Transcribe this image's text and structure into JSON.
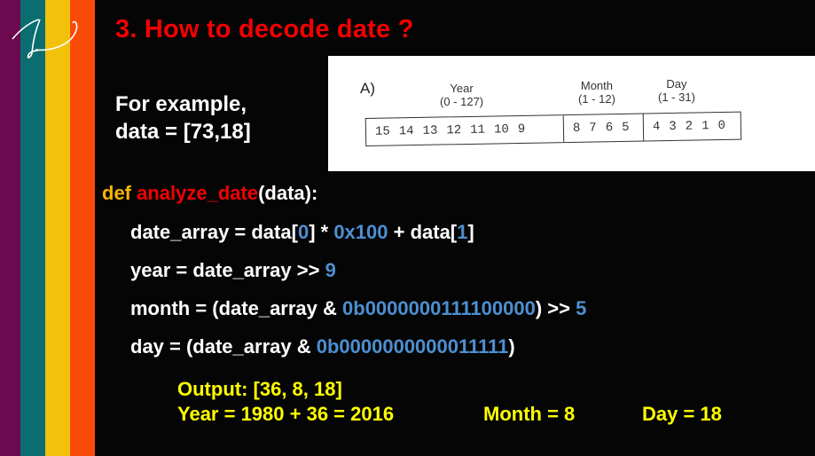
{
  "slide": {
    "title": "3. How to decode date ?",
    "logo_icon": "signature-logo-icon",
    "stripe_colors": [
      "#6b0a4f",
      "#0b6d6f",
      "#f2c10c",
      "#fa4a08"
    ]
  },
  "example": {
    "line1": "For example,",
    "line2": "data = [73,18]"
  },
  "diagram": {
    "label": "A)",
    "fields": [
      {
        "name": "Year",
        "range": "(0 - 127)",
        "bits": [
          "15",
          "14",
          "13",
          "12",
          "11",
          "10",
          "9"
        ]
      },
      {
        "name": "Month",
        "range": "(1 - 12)",
        "bits": [
          "8",
          "7",
          "6",
          "5"
        ]
      },
      {
        "name": "Day",
        "range": "(1 - 31)",
        "bits": [
          "4",
          "3",
          "2",
          "1",
          "0"
        ]
      }
    ]
  },
  "code": {
    "def_kw": "def",
    "func_name": "analyze_date",
    "signature_rest": "(data):",
    "line1": {
      "a": "date_array = data[",
      "n1": "0",
      "b": "] * ",
      "n2": "0x100",
      "c": " + data[",
      "n3": "1",
      "d": "]"
    },
    "line2": {
      "a": "year = date_array >> ",
      "n1": "9"
    },
    "line3": {
      "a": "month = (date_array & ",
      "n1": "0b0000000111100000",
      "b": ") >> ",
      "n2": "5"
    },
    "line4": {
      "a": "day = (date_array & ",
      "n1": "0b0000000000011111",
      "b": ")"
    }
  },
  "output": {
    "line1": "Output: [36, 8, 18]",
    "year": "Year = 1980 + 36 = 2016",
    "month": "Month = 8",
    "day": "Day = 18"
  },
  "colors": {
    "title": "#f40000",
    "keyword": "#f7b500",
    "function": "#f40000",
    "number": "#4d8fd1",
    "output": "#ffff00"
  }
}
